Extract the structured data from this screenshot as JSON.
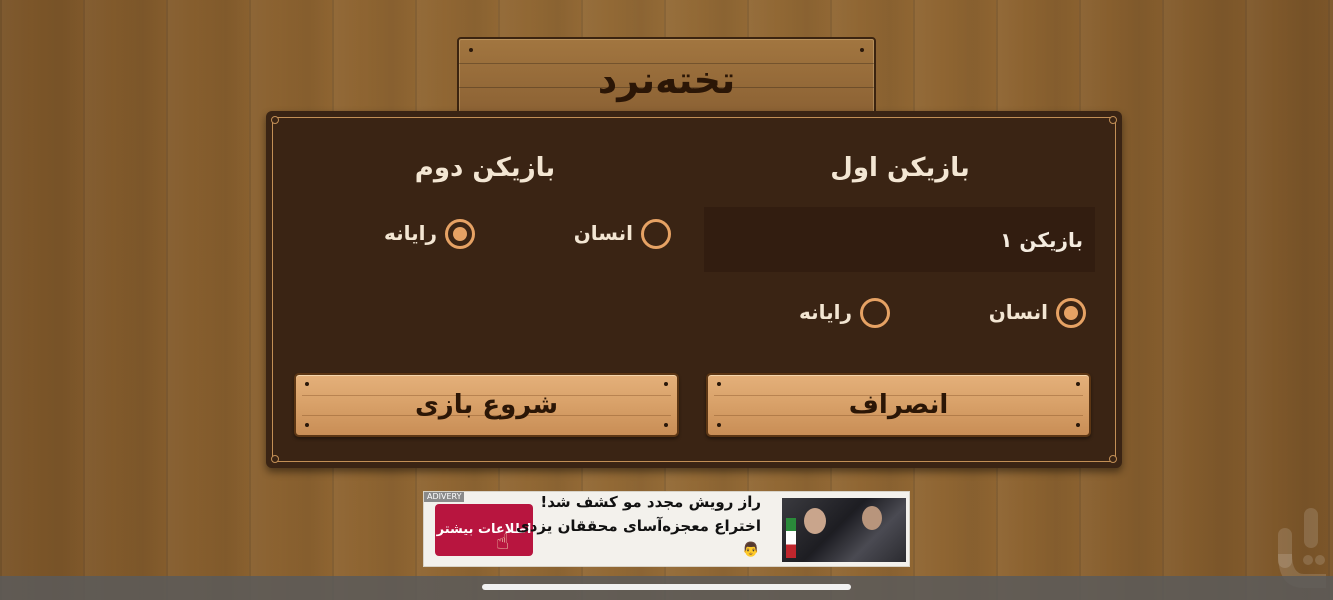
{
  "title": "تخته‌نرد",
  "player1": {
    "heading": "بازیکن اول",
    "name_value": "بازیکن ۱",
    "options": [
      {
        "label": "انسان",
        "checked": true
      },
      {
        "label": "رایانه",
        "checked": false
      }
    ]
  },
  "player2": {
    "heading": "بازیکن دوم",
    "options": [
      {
        "label": "انسان",
        "checked": false
      },
      {
        "label": "رایانه",
        "checked": true
      }
    ]
  },
  "buttons": {
    "start": "شروع بازی",
    "cancel": "انصراف"
  },
  "ad": {
    "tag": "ADIVERY",
    "headline": "راز رویش مجدد مو کشف شد!",
    "subline": "اختراع معجزه‌آسای محققان یزدی",
    "cta": "اطلاعات بیشتر"
  },
  "colors": {
    "panel": "#3a2414",
    "accent": "#e6a264",
    "ad_cta": "#b8153f"
  }
}
